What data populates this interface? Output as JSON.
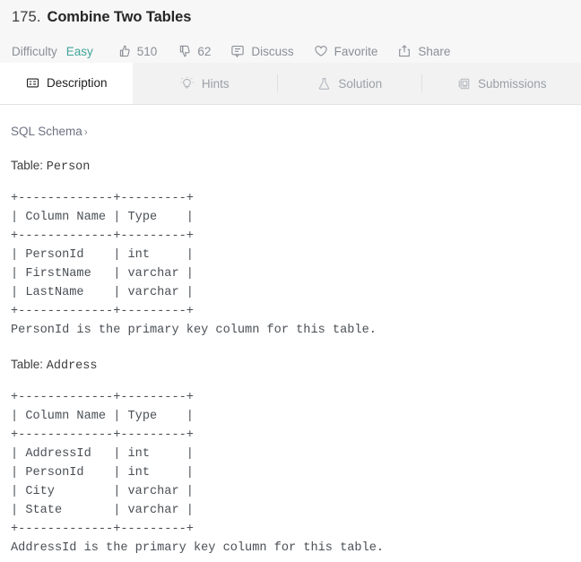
{
  "header": {
    "problem_number": "175.",
    "problem_title": "Combine Two Tables",
    "difficulty_label": "Difficulty",
    "difficulty_value": "Easy",
    "difficulty_color": "#43a59a",
    "likes_icon": "thumbs-up-icon",
    "likes_count": "510",
    "dislikes_icon": "thumbs-down-icon",
    "dislikes_count": "62",
    "discuss_icon": "speech-bubble-icon",
    "discuss_label": "Discuss",
    "favorite_icon": "heart-icon",
    "favorite_label": "Favorite",
    "share_icon": "share-icon",
    "share_label": "Share"
  },
  "tabs": [
    {
      "label": "Description",
      "icon": "description-icon",
      "active": true
    },
    {
      "label": "Hints",
      "icon": "lightbulb-icon",
      "active": false
    },
    {
      "label": "Solution",
      "icon": "flask-icon",
      "active": false
    },
    {
      "label": "Submissions",
      "icon": "submissions-icon",
      "active": false
    }
  ],
  "content": {
    "schema_link": "SQL Schema",
    "schema_chevron": "›",
    "table_label_prefix": "Table: ",
    "person": {
      "name": "Person",
      "ascii": "+-------------+---------+\n| Column Name | Type    |\n+-------------+---------+\n| PersonId    | int     |\n| FirstName   | varchar |\n| LastName    | varchar |\n+-------------+---------+",
      "note": "PersonId is the primary key column for this table."
    },
    "address": {
      "name": "Address",
      "ascii": "+-------------+---------+\n| Column Name | Type    |\n+-------------+---------+\n| AddressId   | int     |\n| PersonId    | int     |\n| City        | varchar |\n| State       | varchar |\n+-------------+---------+",
      "note": "AddressId is the primary key column for this table."
    },
    "schema_tables": [
      {
        "table": "Person",
        "columns": [
          {
            "name": "PersonId",
            "type": "int"
          },
          {
            "name": "FirstName",
            "type": "varchar"
          },
          {
            "name": "LastName",
            "type": "varchar"
          }
        ],
        "primary_key": "PersonId"
      },
      {
        "table": "Address",
        "columns": [
          {
            "name": "AddressId",
            "type": "int"
          },
          {
            "name": "PersonId",
            "type": "int"
          },
          {
            "name": "City",
            "type": "varchar"
          },
          {
            "name": "State",
            "type": "varchar"
          }
        ],
        "primary_key": "AddressId"
      }
    ],
    "ascii_headers": [
      "Column Name",
      "Type"
    ]
  }
}
